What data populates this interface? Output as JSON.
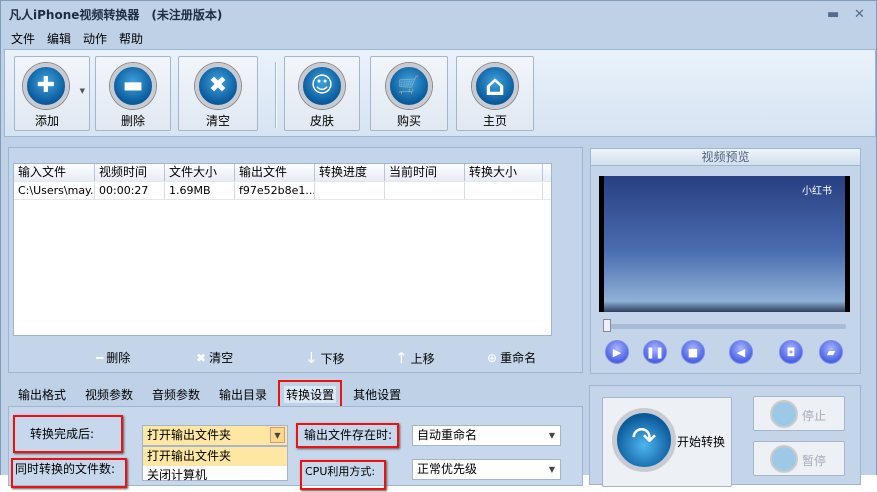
{
  "window": {
    "title": "凡人iPhone视频转换器　(未注册版本)",
    "minimize": "▬",
    "close": "✕"
  },
  "menu": [
    "文件",
    "编辑",
    "动作",
    "帮助"
  ],
  "toolbar": [
    {
      "label": "添加",
      "icon": "plus-icon",
      "glyph": "✚"
    },
    {
      "label": "删除",
      "icon": "minus-icon",
      "glyph": "▬"
    },
    {
      "label": "清空",
      "icon": "clear-x-icon",
      "glyph": "✖"
    },
    {
      "label": "皮肤",
      "icon": "smiley-icon",
      "glyph": "☺"
    },
    {
      "label": "购买",
      "icon": "cart-icon",
      "glyph": "🛒"
    },
    {
      "label": "主页",
      "icon": "home-icon",
      "glyph": "⌂"
    }
  ],
  "table": {
    "columns": [
      "输入文件",
      "视频时间",
      "文件大小",
      "输出文件",
      "转换进度",
      "当前时间",
      "转换大小"
    ],
    "rows": [
      [
        "C:\\Users\\may...",
        "00:00:27",
        "1.69MB",
        "f97e52b8e1...",
        "",
        "",
        ""
      ]
    ]
  },
  "list_actions": [
    {
      "glyph": "━",
      "label": "删除"
    },
    {
      "glyph": "✖",
      "label": "清空"
    },
    {
      "glyph": "↓",
      "label": "下移"
    },
    {
      "glyph": "↑",
      "label": "上移"
    },
    {
      "glyph": "⊕",
      "label": "重命名"
    }
  ],
  "tabs": [
    "输出格式",
    "视频参数",
    "音频参数",
    "输出目录",
    "转换设置",
    "其他设置"
  ],
  "settings": {
    "after_label": "转换完成后:",
    "after_value": "打开输出文件夹",
    "after_options": [
      "打开输出文件夹",
      "关闭计算机"
    ],
    "exists_label": "输出文件存在时:",
    "exists_value": "自动重命名",
    "concurrent_label": "同时转换的文件数:",
    "cpu_label": "CPU利用方式:",
    "cpu_value": "正常优先级"
  },
  "preview": {
    "title": "视频预览",
    "watermark": "小红书",
    "progress": 0.0
  },
  "convert": {
    "start": "开始转换",
    "stop": "停止",
    "pause": "暂停"
  }
}
